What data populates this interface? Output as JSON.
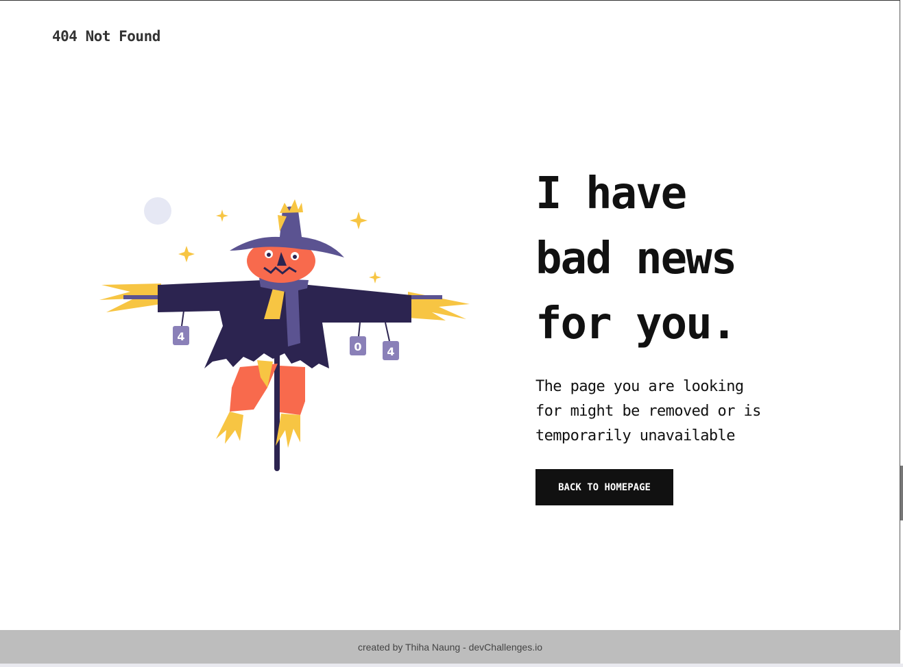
{
  "header": {
    "brand": "404 Not Found"
  },
  "main": {
    "headline_lines": [
      "I have",
      "bad news",
      "for you."
    ],
    "subtext_lines": [
      "The page you are looking",
      "for might be removed or is",
      "temporarily unavailable"
    ],
    "button_label": "BACK TO HOMEPAGE",
    "illustration": {
      "tag_left": "4",
      "tag_mid": "0",
      "tag_right": "4"
    }
  },
  "footer": {
    "credit": "created by Thiha Naung - devChallenges.io"
  },
  "colors": {
    "hat": "#5b5391",
    "coat": "#2c2450",
    "face": "#f86a4d",
    "straw": "#f7c543",
    "moon": "#e6e8f4",
    "button": "#111111",
    "footer_bg": "#bdbdbd"
  }
}
